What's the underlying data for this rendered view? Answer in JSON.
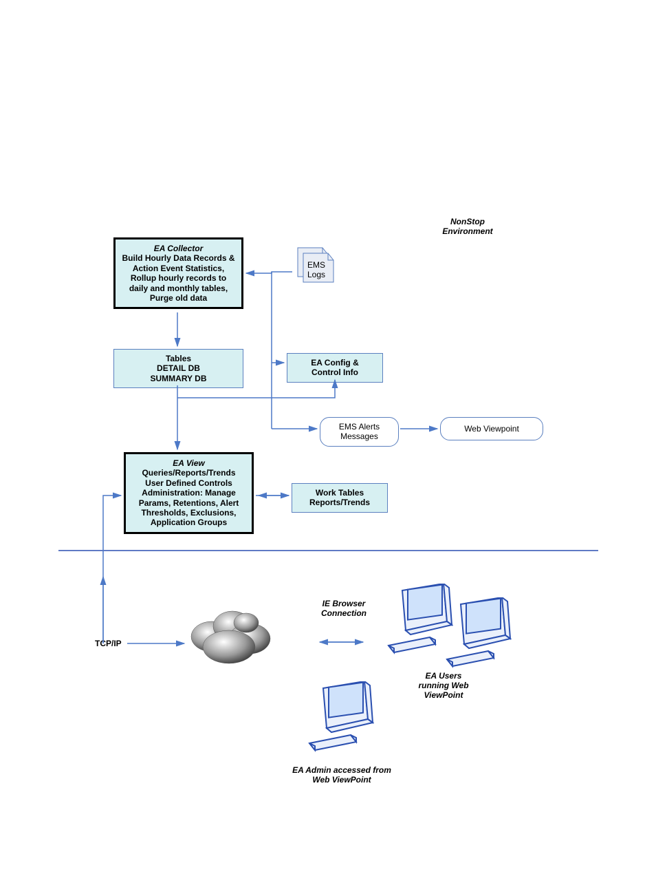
{
  "env_label": "NonStop\nEnvironment",
  "ea_collector": {
    "title": "EA Collector",
    "desc": "Build Hourly Data Records & Action Event Statistics, Rollup hourly records to daily and monthly tables, Purge old data"
  },
  "ems_logs": "EMS\nLogs",
  "tables_box": "Tables\nDETAIL DB\nSUMMARY DB",
  "ea_config": "EA Config &\nControl Info",
  "ems_alerts": "EMS Alerts\nMessages",
  "web_viewpoint": "Web Viewpoint",
  "ea_view": {
    "title": "EA View",
    "desc": "Queries/Reports/Trends\nUser Defined Controls\nAdministration: Manage Params, Retentions, Alert Thresholds, Exclusions, Application Groups"
  },
  "work_tables": "Work Tables\nReports/Trends",
  "tcp_ip": "TCP/IP",
  "ie_browser": "IE Browser\nConnection",
  "ea_users": "EA Users\nrunning Web\nViewPoint",
  "ea_admin": "EA Admin accessed from\nWeb ViewPoint"
}
